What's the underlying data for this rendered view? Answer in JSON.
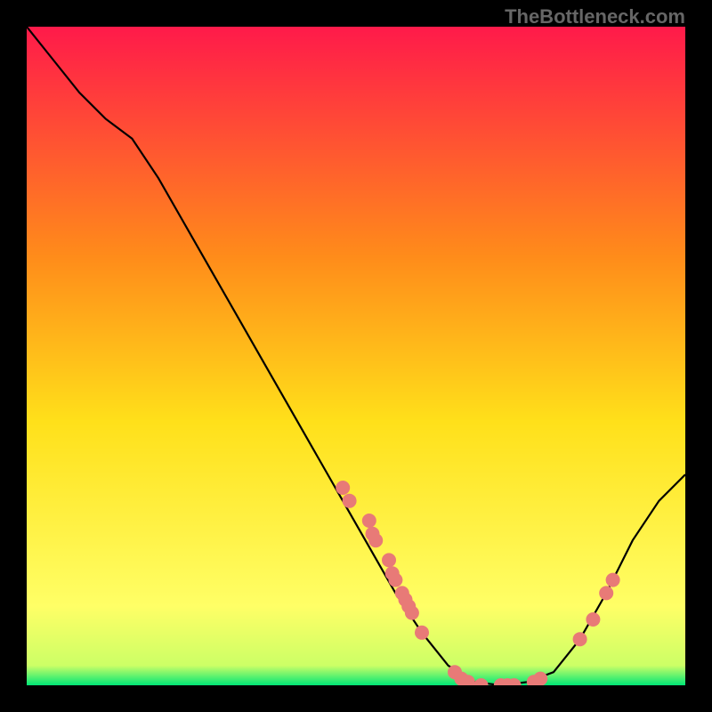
{
  "watermark": "TheBottleneck.com",
  "chart_data": {
    "type": "line",
    "title": "",
    "xlabel": "",
    "ylabel": "",
    "xlim": [
      0,
      100
    ],
    "ylim": [
      0,
      100
    ],
    "background_gradient": {
      "top": "#ff1a4a",
      "mid1": "#ff8c1a",
      "mid2": "#ffe01a",
      "mid3": "#ffff66",
      "bottom": "#00e676"
    },
    "curve": {
      "name": "bottleneck-curve",
      "color": "#000000",
      "points": [
        {
          "x": 0,
          "y": 100
        },
        {
          "x": 4,
          "y": 95
        },
        {
          "x": 8,
          "y": 90
        },
        {
          "x": 12,
          "y": 86
        },
        {
          "x": 16,
          "y": 83
        },
        {
          "x": 20,
          "y": 77
        },
        {
          "x": 24,
          "y": 70
        },
        {
          "x": 28,
          "y": 63
        },
        {
          "x": 32,
          "y": 56
        },
        {
          "x": 36,
          "y": 49
        },
        {
          "x": 40,
          "y": 42
        },
        {
          "x": 44,
          "y": 35
        },
        {
          "x": 48,
          "y": 28
        },
        {
          "x": 52,
          "y": 21
        },
        {
          "x": 56,
          "y": 14
        },
        {
          "x": 60,
          "y": 8
        },
        {
          "x": 64,
          "y": 3
        },
        {
          "x": 68,
          "y": 0.5
        },
        {
          "x": 72,
          "y": 0
        },
        {
          "x": 76,
          "y": 0.5
        },
        {
          "x": 80,
          "y": 2
        },
        {
          "x": 84,
          "y": 7
        },
        {
          "x": 88,
          "y": 14
        },
        {
          "x": 92,
          "y": 22
        },
        {
          "x": 96,
          "y": 28
        },
        {
          "x": 100,
          "y": 32
        }
      ]
    },
    "scatter": {
      "name": "data-points",
      "color": "#e87a77",
      "points": [
        {
          "x": 48,
          "y": 30
        },
        {
          "x": 49,
          "y": 28
        },
        {
          "x": 52,
          "y": 25
        },
        {
          "x": 52.5,
          "y": 23
        },
        {
          "x": 53,
          "y": 22
        },
        {
          "x": 55,
          "y": 19
        },
        {
          "x": 55.5,
          "y": 17
        },
        {
          "x": 56,
          "y": 16
        },
        {
          "x": 57,
          "y": 14
        },
        {
          "x": 57.5,
          "y": 13
        },
        {
          "x": 58,
          "y": 12
        },
        {
          "x": 58.5,
          "y": 11
        },
        {
          "x": 60,
          "y": 8
        },
        {
          "x": 65,
          "y": 2
        },
        {
          "x": 66,
          "y": 1
        },
        {
          "x": 67,
          "y": 0.5
        },
        {
          "x": 69,
          "y": 0
        },
        {
          "x": 72,
          "y": 0
        },
        {
          "x": 73,
          "y": 0
        },
        {
          "x": 74,
          "y": 0
        },
        {
          "x": 77,
          "y": 0.5
        },
        {
          "x": 78,
          "y": 1
        },
        {
          "x": 84,
          "y": 7
        },
        {
          "x": 86,
          "y": 10
        },
        {
          "x": 88,
          "y": 14
        },
        {
          "x": 89,
          "y": 16
        }
      ]
    }
  }
}
